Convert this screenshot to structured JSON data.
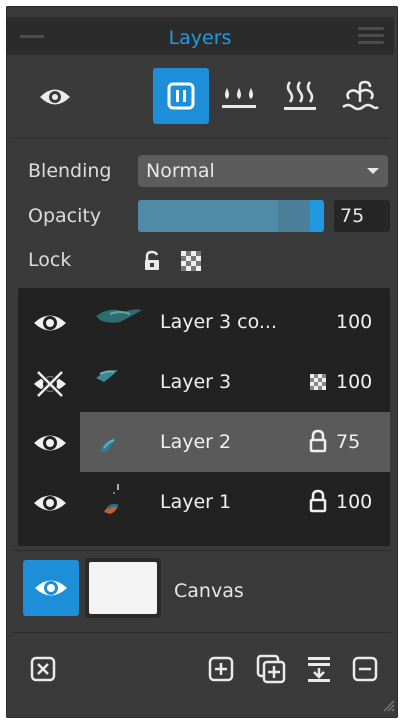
{
  "panel": {
    "title": "Layers"
  },
  "toolbar": {
    "buttons": [
      {
        "icon": "visibility-toggle-icon"
      },
      {
        "icon": "pause-icon",
        "active": true
      },
      {
        "icon": "water-drops-icon"
      },
      {
        "icon": "steam-icon"
      },
      {
        "icon": "fountain-icon"
      }
    ]
  },
  "properties": {
    "blending_label": "Blending",
    "blending_value": "Normal",
    "opacity_label": "Opacity",
    "opacity_value": "75",
    "opacity_fraction": 0.75,
    "lock_label": "Lock"
  },
  "layers": [
    {
      "name": "Layer 3 co...",
      "value": "100",
      "visible": true,
      "badge": "",
      "selected": false
    },
    {
      "name": "Layer 3",
      "value": "100",
      "visible": false,
      "badge": "checker-icon",
      "selected": false
    },
    {
      "name": "Layer 2",
      "value": "75",
      "visible": true,
      "badge": "lock-icon",
      "selected": true
    },
    {
      "name": "Layer 1",
      "value": "100",
      "visible": true,
      "badge": "lock-icon",
      "selected": false
    }
  ],
  "canvas": {
    "label": "Canvas"
  },
  "footer": {
    "buttons": [
      "close-layer-icon",
      "add-layer-icon",
      "duplicate-layer-icon",
      "merge-down-icon",
      "remove-layer-icon"
    ]
  },
  "colors": {
    "accent": "#1c8fd8",
    "title": "#1f9ae0",
    "panel_bg": "#3a3a3a",
    "list_bg": "#222222",
    "selected_row": "#5a5a5a"
  }
}
